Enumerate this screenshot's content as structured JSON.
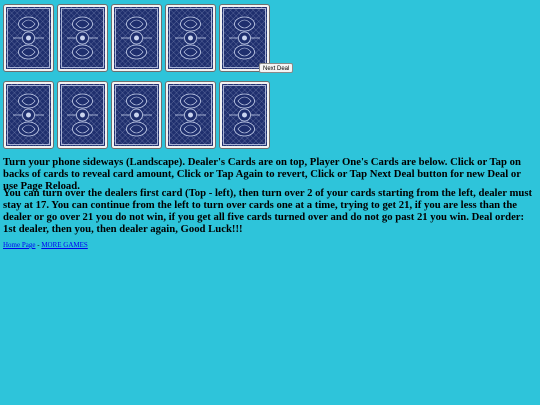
{
  "dealer_cards": [
    {
      "state": "face-down",
      "back_icon": "card-back-pattern-icon"
    },
    {
      "state": "face-down",
      "back_icon": "card-back-pattern-icon"
    },
    {
      "state": "face-down",
      "back_icon": "card-back-pattern-icon"
    },
    {
      "state": "face-down",
      "back_icon": "card-back-pattern-icon"
    },
    {
      "state": "face-down",
      "back_icon": "card-back-pattern-icon"
    }
  ],
  "player_cards": [
    {
      "state": "face-down",
      "back_icon": "card-back-pattern-icon"
    },
    {
      "state": "face-down",
      "back_icon": "card-back-pattern-icon"
    },
    {
      "state": "face-down",
      "back_icon": "card-back-pattern-icon"
    },
    {
      "state": "face-down",
      "back_icon": "card-back-pattern-icon"
    },
    {
      "state": "face-down",
      "back_icon": "card-back-pattern-icon"
    }
  ],
  "next_deal_label": "Next Deal",
  "instructions": "Turn your phone sideways (Landscape). Dealer's Cards are on top, Player One's Cards are below. Click or Tap on backs of cards to reveal card amount, Click or Tap Again to revert, Click or Tap Next Deal button for new Deal or use Page Reload.",
  "rules": "You can turn over the dealers first card (Top - left), then turn over 2 of your cards starting from the left, dealer must stay at 17. You can continue from the left to turn over cards one at a time, trying to get 21, if you are less than the dealer or go over 21 you do not win, if you get all five cards turned over and do not go past 21 you win. Deal order: 1st dealer, then you, then dealer again, Good Luck!!!",
  "footer": {
    "home_link": "Home Page",
    "separator": " - ",
    "more_games_link": "MORE GAMES"
  },
  "colors": {
    "background": "#2ec4da",
    "card_back": "#1f2f6e",
    "card_pattern": "#c9d3ee"
  }
}
